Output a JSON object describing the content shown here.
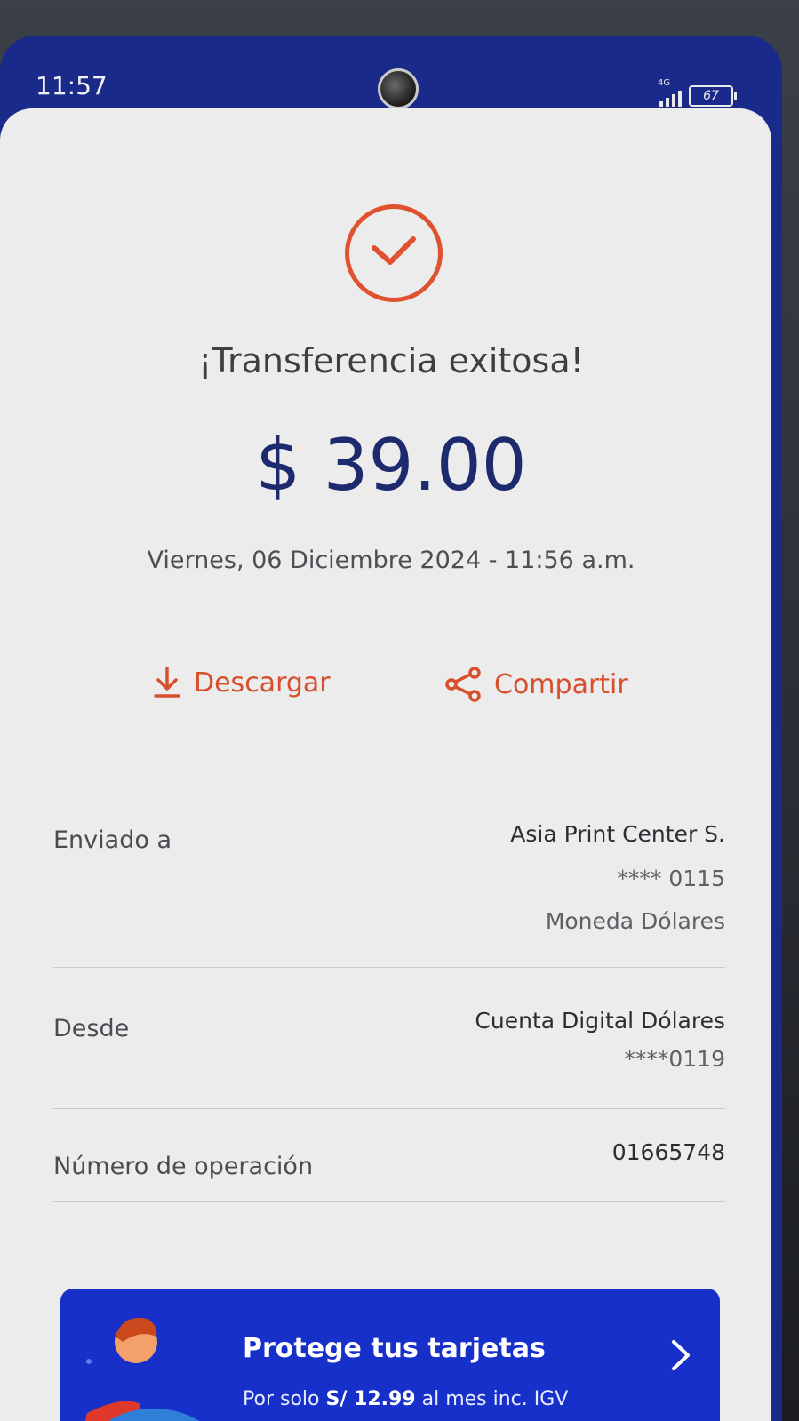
{
  "status_bar": {
    "time": "11:57",
    "network": "4G",
    "battery": "67"
  },
  "receipt": {
    "title": "¡Transferencia exitosa!",
    "amount": "$ 39.00",
    "datetime": "Viernes, 06 Diciembre 2024 - 11:56 a.m.",
    "download_label": "Descargar",
    "share_label": "Compartir"
  },
  "details": {
    "sent_to": {
      "label": "Enviado a",
      "name": "Asia Print Center S.",
      "account": "**** 0115",
      "currency": "Moneda Dólares"
    },
    "from": {
      "label": "Desde",
      "account_name": "Cuenta Digital Dólares",
      "account": "****0119"
    },
    "operation": {
      "label": "Número de operación",
      "value": "01665748"
    }
  },
  "promo": {
    "title": "Protege tus tarjetas",
    "sub_prefix": "Por solo ",
    "sub_price": "S/ 12.99",
    "sub_suffix": " al mes inc. IGV"
  },
  "colors": {
    "accent": "#e0522f",
    "amount": "#1e2a6e",
    "brand_blue": "#1730c9",
    "status_bar": "#1a2a8a"
  },
  "icons": {
    "success": "check-circle-icon",
    "download": "download-icon",
    "share": "share-icon",
    "promo_arrow": "chevron-right-icon"
  }
}
